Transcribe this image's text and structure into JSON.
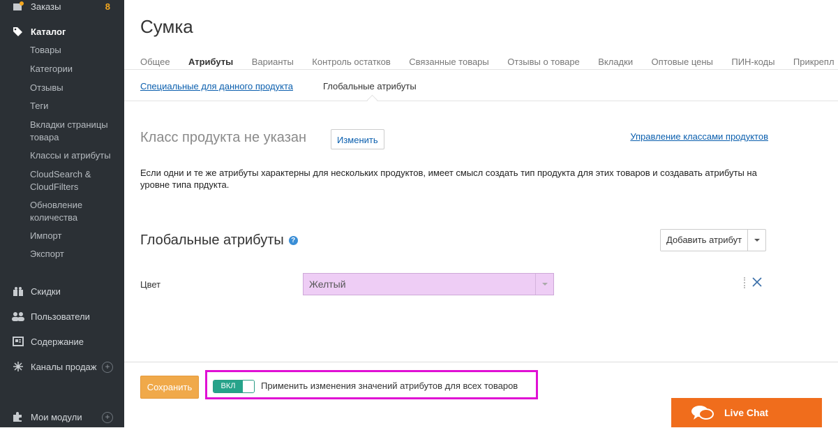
{
  "sidebar": {
    "orders": {
      "label": "Заказы",
      "count": "8"
    },
    "catalog": {
      "label": "Каталог"
    },
    "catalog_items": [
      {
        "label": "Товары"
      },
      {
        "label": "Категории"
      },
      {
        "label": "Отзывы"
      },
      {
        "label": "Теги"
      },
      {
        "label": "Вкладки страницы товара"
      },
      {
        "label": "Классы и атрибуты"
      },
      {
        "label": "CloudSearch & CloudFilters"
      },
      {
        "label": "Обновление количества"
      },
      {
        "label": "Импорт"
      },
      {
        "label": "Экспорт"
      }
    ],
    "discounts": {
      "label": "Скидки"
    },
    "users": {
      "label": "Пользователи"
    },
    "content": {
      "label": "Содержание"
    },
    "sales_channels": {
      "label": "Каналы продаж"
    },
    "modules": {
      "label": "Мои модули"
    }
  },
  "page": {
    "title": "Сумка",
    "tabs": [
      {
        "label": "Общее"
      },
      {
        "label": "Атрибуты"
      },
      {
        "label": "Варианты"
      },
      {
        "label": "Контроль остатков"
      },
      {
        "label": "Связанные товары"
      },
      {
        "label": "Отзывы о товаре"
      },
      {
        "label": "Вкладки"
      },
      {
        "label": "Оптовые цены"
      },
      {
        "label": "ПИН-коды"
      },
      {
        "label": "Прикрепл"
      }
    ],
    "subtabs": {
      "specific": "Специальные для данного продукта",
      "global": "Глобальные атрибуты"
    }
  },
  "product_class": {
    "title": "Класс продукта не указан",
    "change_button": "Изменить",
    "manage_link": "Управление классами продуктов",
    "description": "Если одни и те же атрибуты характерны для нескольких продуктов, имеет смысл создать тип продукта для этих товаров и создавать атрибуты на уровне типа прдукта."
  },
  "global_attributes": {
    "title": "Глобальные атрибуты",
    "add_button": "Добавить атрибут",
    "rows": [
      {
        "label": "Цвет",
        "value": "Желтый"
      }
    ]
  },
  "bottom": {
    "save_button": "Сохранить",
    "toggle_label": "ВКЛ",
    "apply_label": "Применить изменения значений атрибутов для всех товаров"
  },
  "live_chat": {
    "label": "Live Chat"
  },
  "colors": {
    "sidebar_bg": "#2b3035",
    "accent_orange": "#f0a94a",
    "live_chat": "#f06d1c",
    "toggle_green": "#26a38a",
    "highlight": "#e010d4",
    "link_blue": "#0b5fae"
  }
}
